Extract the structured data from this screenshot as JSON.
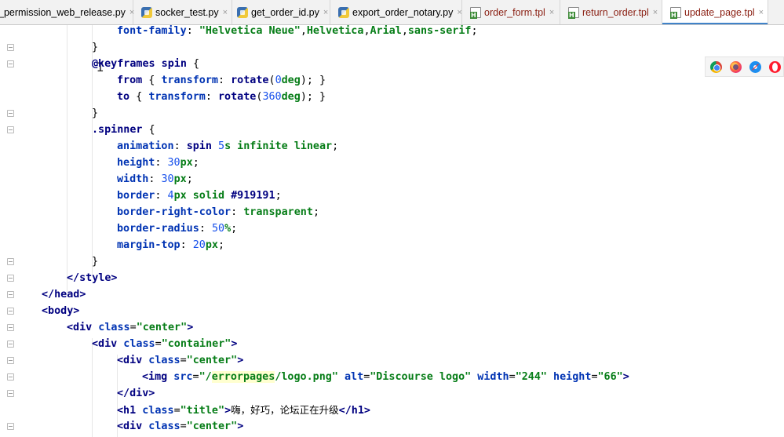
{
  "tabs": [
    {
      "label": "_permission_web_release.py",
      "type": "py",
      "active": false
    },
    {
      "label": "socker_test.py",
      "type": "py",
      "active": false
    },
    {
      "label": "get_order_id.py",
      "type": "py",
      "active": false
    },
    {
      "label": "export_order_notary.py",
      "type": "py",
      "active": false
    },
    {
      "label": "order_form.tpl",
      "type": "tpl",
      "active": false
    },
    {
      "label": "return_order.tpl",
      "type": "tpl",
      "active": false
    },
    {
      "label": "update_page.tpl",
      "type": "tpl",
      "active": true
    }
  ],
  "tab_close_glyph": "×",
  "code": {
    "l1": {
      "prop": "font-family",
      "sep": ": ",
      "str": "\"Helvetica Neue\"",
      "rest1": ",",
      "v1": "Helvetica",
      "rest2": ",",
      "v2": "Arial",
      "rest3": ",",
      "v3": "sans-serif",
      "end": ";"
    },
    "l2": "}",
    "l3": {
      "kw": "@keyframes",
      "name": " spin ",
      "brace": "{"
    },
    "l4": {
      "sel": "from",
      "open": " { ",
      "prop": "transform",
      "sep": ": ",
      "fn": "rotate",
      "p1": "(",
      "num": "0",
      "unit": "deg",
      "p2": "); }"
    },
    "l5": {
      "sel": "to",
      "open": " { ",
      "prop": "transform",
      "sep": ": ",
      "fn": "rotate",
      "p1": "(",
      "num": "360",
      "unit": "deg",
      "p2": "); }"
    },
    "l6": "}",
    "l7": {
      "sel": ".spinner",
      "brace": " {"
    },
    "l8": {
      "prop": "animation",
      "sep": ": ",
      "v1": "spin",
      "sp": " ",
      "num": "5",
      "unit": "s",
      "v2": " infinite linear",
      "end": ";"
    },
    "l9": {
      "prop": "height",
      "sep": ": ",
      "num": "30",
      "unit": "px",
      "end": ";"
    },
    "l10": {
      "prop": "width",
      "sep": ": ",
      "num": "30",
      "unit": "px",
      "end": ";"
    },
    "l11": {
      "prop": "border",
      "sep": ": ",
      "num": "4",
      "unit": "px",
      "v1": " solid",
      "v2": " #919191",
      "end": ";"
    },
    "l12": {
      "prop": "border-right-color",
      "sep": ": ",
      "v1": "transparent",
      "end": ";"
    },
    "l13": {
      "prop": "border-radius",
      "sep": ": ",
      "num": "50",
      "unit": "%",
      "end": ";"
    },
    "l14": {
      "prop": "margin-top",
      "sep": ": ",
      "num": "20",
      "unit": "px",
      "end": ";"
    },
    "l15": "}",
    "l16": "</style>",
    "l17": "</head>",
    "l18": "<body>",
    "l19": {
      "open": "<div",
      "attr": " class",
      "eq": "=",
      "str": "\"center\"",
      "close": ">"
    },
    "l20": {
      "open": "<div",
      "attr": " class",
      "eq": "=",
      "str": "\"container\"",
      "close": ">"
    },
    "l21": {
      "open": "<div",
      "attr": " class",
      "eq": "=",
      "str": "\"center\"",
      "close": ">"
    },
    "l22": {
      "open": "<img",
      "a1": " src",
      "eq1": "=",
      "s1a": "\"/",
      "s1b": "errorpages",
      "s1c": "/logo.png\"",
      "a2": " alt",
      "eq2": "=",
      "s2": "\"Discourse logo\"",
      "a3": " width",
      "eq3": "=",
      "s3": "\"244\"",
      "a4": " height",
      "eq4": "=",
      "s4": "\"66\"",
      "close": ">"
    },
    "l23": "</div>",
    "l24": {
      "open": "<h1",
      "attr": " class",
      "eq": "=",
      "str": "\"title\"",
      "close": ">",
      "text": "嗨，好巧，论坛正在升级",
      "end": "</h1>"
    },
    "l25": {
      "open": "<div",
      "attr": " class",
      "eq": "=",
      "str": "\"center\"",
      "close": ">"
    }
  },
  "browser_icons": [
    "chrome-icon",
    "firefox-icon",
    "safari-icon",
    "opera-icon"
  ]
}
